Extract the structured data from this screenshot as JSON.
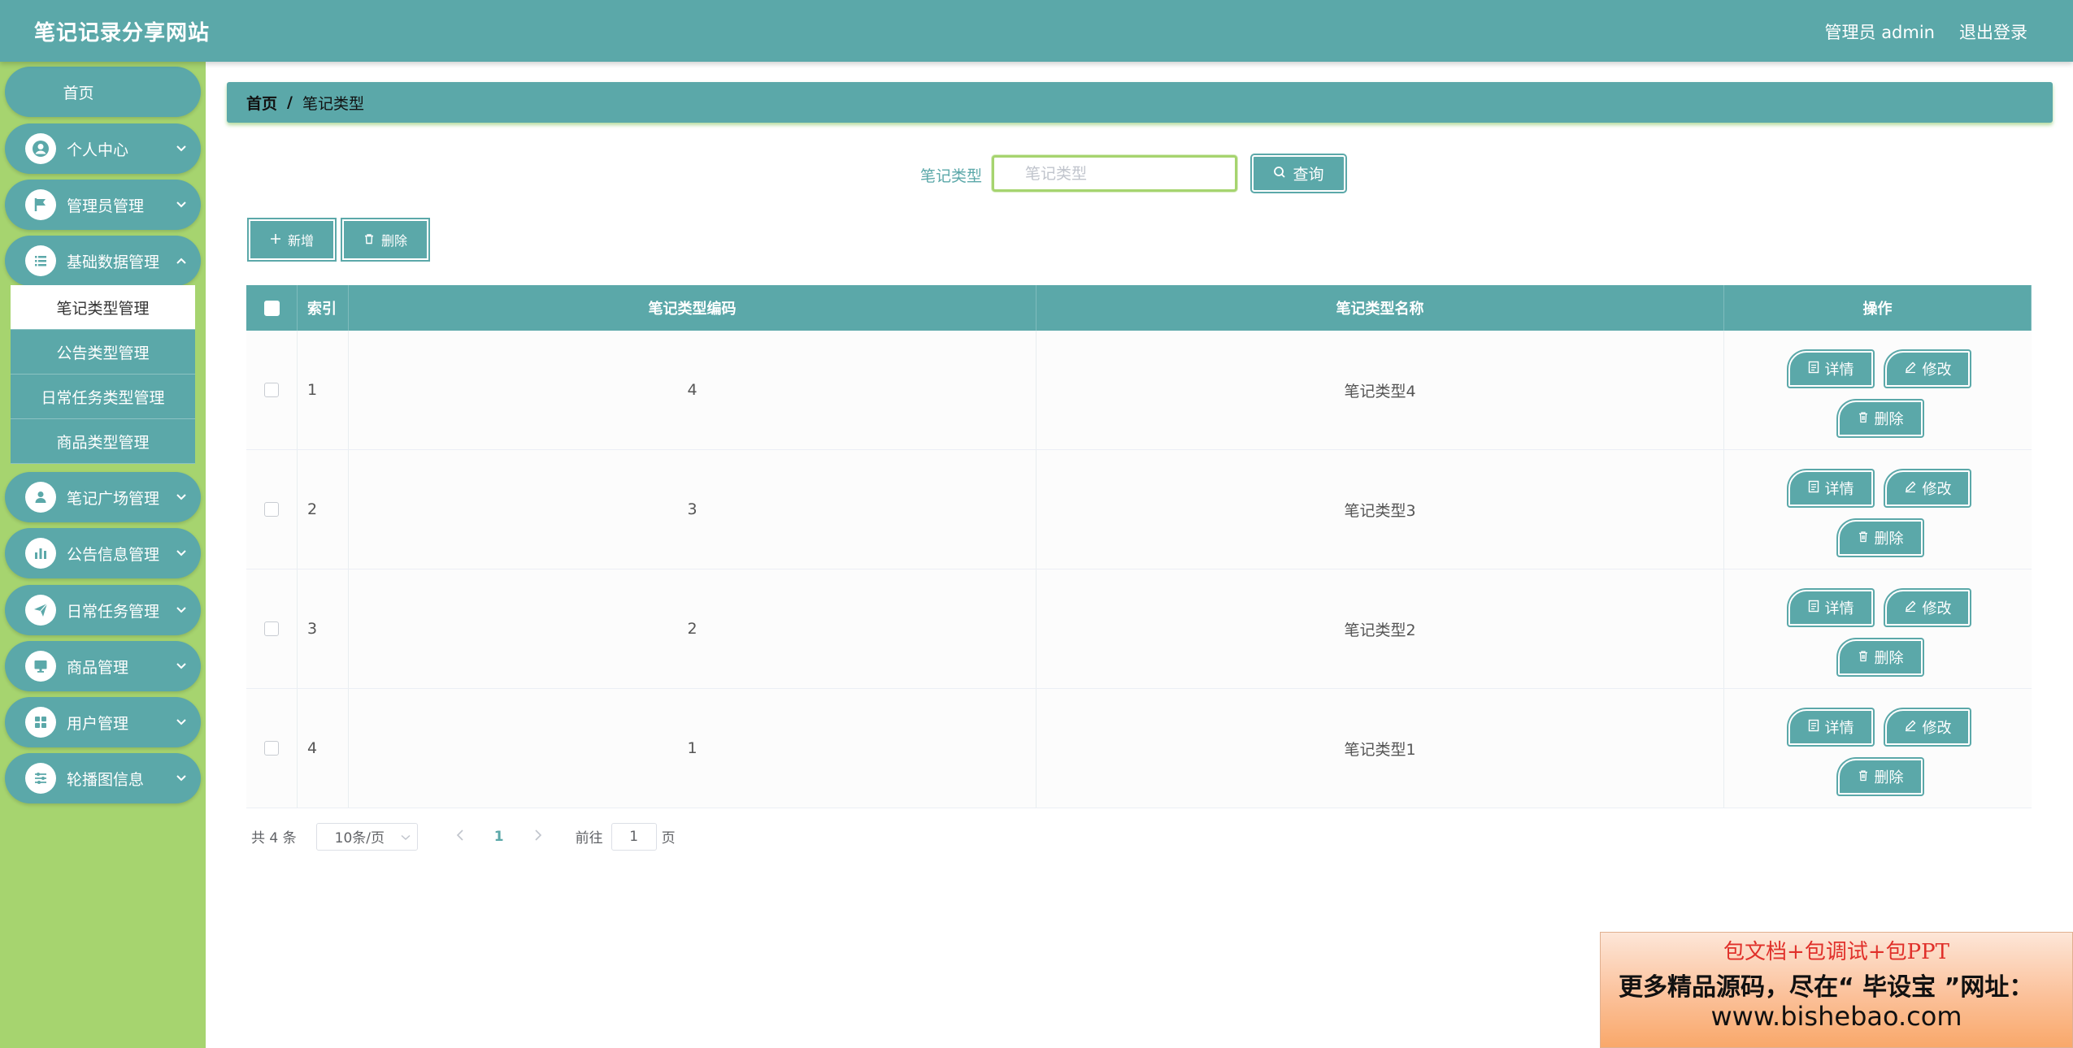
{
  "header": {
    "title": "笔记记录分享网站",
    "user_label": "管理员 admin",
    "logout_label": "退出登录"
  },
  "sidebar": {
    "home": "首页",
    "items": [
      {
        "label": "个人中心",
        "icon": "user-icon"
      },
      {
        "label": "管理员管理",
        "icon": "flag-icon"
      },
      {
        "label": "基础数据管理",
        "icon": "list-icon"
      },
      {
        "label": "笔记广场管理",
        "icon": "person-icon"
      },
      {
        "label": "公告信息管理",
        "icon": "bar-chart-icon"
      },
      {
        "label": "日常任务管理",
        "icon": "paper-plane-icon"
      },
      {
        "label": "商品管理",
        "icon": "monitor-icon"
      },
      {
        "label": "用户管理",
        "icon": "grid-icon"
      },
      {
        "label": "轮播图信息",
        "icon": "sliders-icon"
      }
    ],
    "submenu": [
      {
        "label": "笔记类型管理",
        "active": true
      },
      {
        "label": "公告类型管理",
        "active": false
      },
      {
        "label": "日常任务类型管理",
        "active": false
      },
      {
        "label": "商品类型管理",
        "active": false
      }
    ]
  },
  "breadcrumb": {
    "home": "首页",
    "separator": "/",
    "current": "笔记类型"
  },
  "search": {
    "label": "笔记类型",
    "placeholder": "笔记类型",
    "value": "",
    "button_label": "查询"
  },
  "actions": {
    "add_label": "新增",
    "delete_label": "删除"
  },
  "table": {
    "headers": {
      "index": "索引",
      "code": "笔记类型编码",
      "name": "笔记类型名称",
      "ops": "操作"
    },
    "rows": [
      {
        "index": "1",
        "code": "4",
        "name": "笔记类型4"
      },
      {
        "index": "2",
        "code": "3",
        "name": "笔记类型3"
      },
      {
        "index": "3",
        "code": "2",
        "name": "笔记类型2"
      },
      {
        "index": "4",
        "code": "1",
        "name": "笔记类型1"
      }
    ],
    "op_labels": {
      "detail": "详情",
      "edit": "修改",
      "delete": "删除"
    }
  },
  "pagination": {
    "total": "共 4 条",
    "page_size": "10条/页",
    "current_page": "1",
    "goto_label": "前往",
    "goto_value": "1",
    "unit": "页"
  },
  "ad": {
    "line1": "包文档+包调试+包PPT",
    "line2": "更多精品源码，尽在“ 毕设宝 ”网址：",
    "line3": "www.bishebao.com"
  },
  "colors": {
    "primary": "#5ba8a9",
    "sidebar_bg": "#a6d46f",
    "accent_text": "#e0302a"
  }
}
